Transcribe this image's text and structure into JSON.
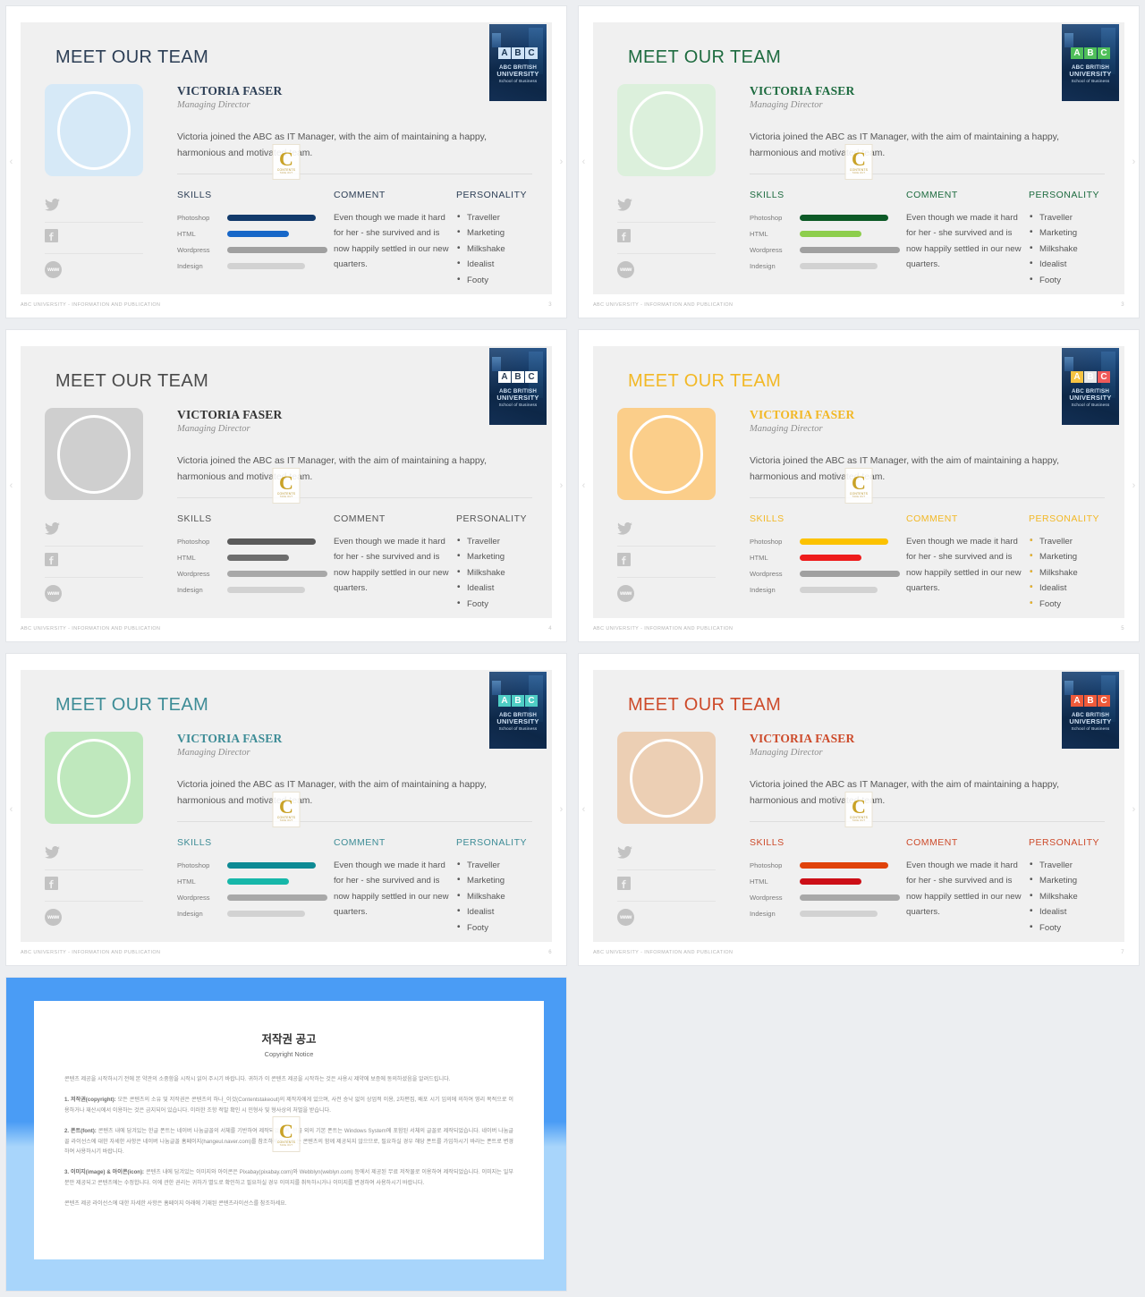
{
  "common": {
    "title": "MEET OUR TEAM",
    "person_name": "VICTORIA FASER",
    "person_role": "Managing Director",
    "bio": "Victoria joined the ABC as IT Manager, with the aim of maintaining a happy, harmonious and motivated team.",
    "heading_skills": "SKILLS",
    "heading_comment": "COMMENT",
    "heading_personality": "PERSONALITY",
    "comment_text": "Even though we made it hard for her - she survived and is now happily settled in our new quarters.",
    "skills": [
      {
        "label": "Photoshop",
        "value": 88
      },
      {
        "label": "HTML",
        "value": 62
      },
      {
        "label": "Wordpress",
        "value": 100
      },
      {
        "label": "Indesign",
        "value": 78
      }
    ],
    "personality": [
      "Traveller",
      "Marketing",
      "Milkshake",
      "Idealist",
      "Footy"
    ],
    "footer_text": "ABC UNIVERSITY - INFORMATION AND PUBLICATION",
    "social": [
      "twitter-icon",
      "facebook-icon",
      "website-icon"
    ],
    "www_label": "www",
    "logo": {
      "letters": [
        "A",
        "B",
        "C"
      ],
      "line1": "ABC  BRITISH",
      "line2": "UNIVERSITY",
      "line3": "School  of  Business"
    },
    "watermark": {
      "letter": "C",
      "line1": "CONTENTS",
      "line2": "TAKE  OUT"
    },
    "nav_prev": "‹",
    "nav_next": "›"
  },
  "slides": [
    {
      "id": "slide-blue",
      "page": "3",
      "title_color": "#2c3e55",
      "heading_color": "#2c3e55",
      "name_color": "#2c3e55",
      "bullet_color": "#575757",
      "avatar_bg": "#d6e9f7",
      "bar_colors": [
        "#123a6b",
        "#1767c8",
        "#a0a0a0",
        "#d2d2d2"
      ],
      "logo_letter_bg": [
        "#cfe3f6",
        "#cfe3f6",
        "#cfe3f6"
      ],
      "logo_letter_fg": "#17324f"
    },
    {
      "id": "slide-green",
      "page": "3",
      "title_color": "#1d6b3f",
      "heading_color": "#1d6b3f",
      "name_color": "#1d6b3f",
      "bullet_color": "#575757",
      "avatar_bg": "#dcf0dc",
      "bar_colors": [
        "#0d5a27",
        "#8dce4c",
        "#a0a0a0",
        "#d2d2d2"
      ],
      "logo_letter_bg": [
        "#4fbf5a",
        "#4fbf5a",
        "#4fbf5a"
      ],
      "logo_letter_fg": "#ffffff"
    },
    {
      "id": "slide-gray",
      "page": "4",
      "title_color": "#4a4a4a",
      "heading_color": "#555555",
      "name_color": "#333333",
      "bullet_color": "#575757",
      "avatar_bg": "#cfcfcf",
      "bar_colors": [
        "#5a5a5a",
        "#6d6d6d",
        "#a8a8a8",
        "#d2d2d2"
      ],
      "logo_letter_bg": [
        "#ffffff",
        "#ffffff",
        "#ffffff"
      ],
      "logo_letter_fg": "#2c3e55"
    },
    {
      "id": "slide-yellow",
      "page": "5",
      "title_color": "#f2b825",
      "heading_color": "#f2b825",
      "name_color": "#f2b825",
      "bullet_color": "#f2b825",
      "avatar_bg": "#fbce8a",
      "bar_colors": [
        "#fcc200",
        "#ee1c1c",
        "#a0a0a0",
        "#d2d2d2"
      ],
      "logo_letter_bg": [
        "#f6c343",
        "#e9e9e9",
        "#ef5a5a"
      ],
      "logo_letter_fg": "#ffffff"
    },
    {
      "id": "slide-teal",
      "page": "6",
      "title_color": "#3d8c96",
      "heading_color": "#3d8c96",
      "name_color": "#3d8c96",
      "bullet_color": "#575757",
      "avatar_bg": "#bfe8bd",
      "bar_colors": [
        "#0e8a94",
        "#17b7a9",
        "#a8a8a8",
        "#d2d2d2"
      ],
      "logo_letter_bg": [
        "#4ecdc4",
        "#4ecdc4",
        "#4ecdc4"
      ],
      "logo_letter_fg": "#ffffff"
    },
    {
      "id": "slide-red",
      "page": "7",
      "title_color": "#cd4a2a",
      "heading_color": "#cd4a2a",
      "name_color": "#cd4a2a",
      "bullet_color": "#575757",
      "avatar_bg": "#eccfb4",
      "bar_colors": [
        "#e0430b",
        "#cc0f17",
        "#a8a8a8",
        "#d2d2d2"
      ],
      "logo_letter_bg": [
        "#ef5a3a",
        "#ef5a3a",
        "#ef5a3a"
      ],
      "logo_letter_fg": "#ffffff"
    }
  ],
  "copyright": {
    "title": "저작권 공고",
    "subtitle": "Copyright Notice",
    "paragraphs": [
      "콘텐츠 제공을 시작하시기 전에 본 약관의 소중함을 시작시 읽어 주시기 바랍니다. 귀하가 이 콘텐츠 제공을 시작하는 것은 사용시 제약에 보증에 동의하셨음을 알려드립니다.",
      "<b>1. 저작권(copyright):</b> 모든 콘텐츠의 소유 및 저작권은 콘텐츠의 하나_이것(Contentstakeout)의 제작자에게 있으며, 사전 승낙 없이 상업적 이용, 2차편집, 배포 시기 임의에 의하여 영리 목적으로 이용하거나 재산시에서 이용하는 것은 금지되어 있습니다. 이러한 조항 적발 확인 시 민형사 및 형사상의 처벌을 받습니다.",
      "<b>2. 폰트(font):</b> 콘텐츠 내에 담겨있는 한글 폰트는 네이버 나눔글꼴의 서체를 기반하여 제작되었으며, 한글 외의 기본 폰트는 Windows System에 포함된 서체의 글꼴로 제작되었습니다. 네이버 나눔글꼴 라이선스에 대한 자세한 사항은 네이버 나눔글꼴 홈페이지(hangeul.naver.com)를 참조하세요. 폰트는 콘텐츠의 함께 제공되지 않으므로, 필요하실 경우 해당 폰트를 가입하시기 바라는 폰트로 변경하여 사용하시기 바랍니다.",
      "<b>3. 이미지(image) & 아이콘(icon):</b> 콘텐츠 내에 담겨있는 이미지와 아이콘은 Pixabay(pixabay.com)와 Webblyn(weblyn.com) 등에서 제공된 무료 저작물로 이용하여 제작되었습니다. 이미지는 일부분만 제공되고 콘텐츠에는 수정합니다. 이에 관한 권리는 귀하가 별도로 확인하고 필요하실 경우 이미지를 취득하시거나 이미지를 변경하여 사용하시기 바랍니다.",
      "콘텐츠 제공 라이선스에 대한 자세한 사항은 홈페이지 아래에 기재된 콘텐츠라이선스를 참조하세요."
    ]
  }
}
